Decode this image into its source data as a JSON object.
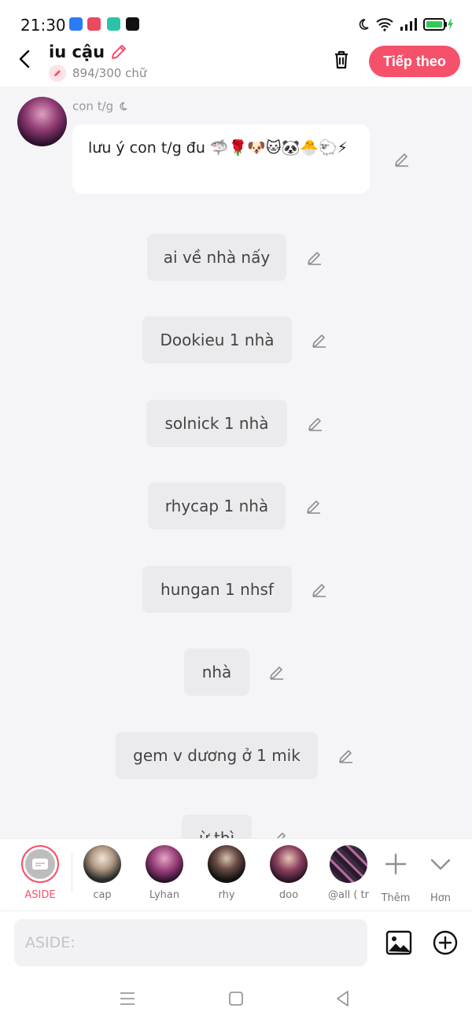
{
  "status": {
    "time": "21:30"
  },
  "header": {
    "title": "iu cậu",
    "char_count": "894/300 chữ",
    "next_label": "Tiếp theo"
  },
  "first_message": {
    "author": "con t/g",
    "text": "lưu ý con t/g đu 🦈🌹🐶🐱🐼🐣🐑⚡"
  },
  "messages": [
    "ai về nhà nấy",
    "Dookieu 1 nhà",
    "solnick 1 nhà",
    "rhycap 1 nhà",
    "hungan 1 nhsf",
    "nhà",
    "gem v dương ở 1 mik",
    "ừ thì"
  ],
  "mentions": {
    "aside_label": "ASIDE",
    "people": [
      "cap",
      "Lyhan",
      "rhy",
      "doo",
      "@all ( tr"
    ],
    "more_label": "Thêm",
    "collapse_label": "Hơn"
  },
  "input": {
    "placeholder": "ASIDE:"
  },
  "colors": {
    "accent": "#f6516a",
    "bubble": "#ebebed",
    "background": "#f5f5f7"
  },
  "icons": [
    "back-arrow-icon",
    "pencil-icon",
    "trash-icon",
    "image-icon",
    "plus-circle-icon",
    "plus-icon",
    "chevron-down-icon",
    "menu-icon",
    "home-square-icon",
    "back-triangle-icon"
  ]
}
